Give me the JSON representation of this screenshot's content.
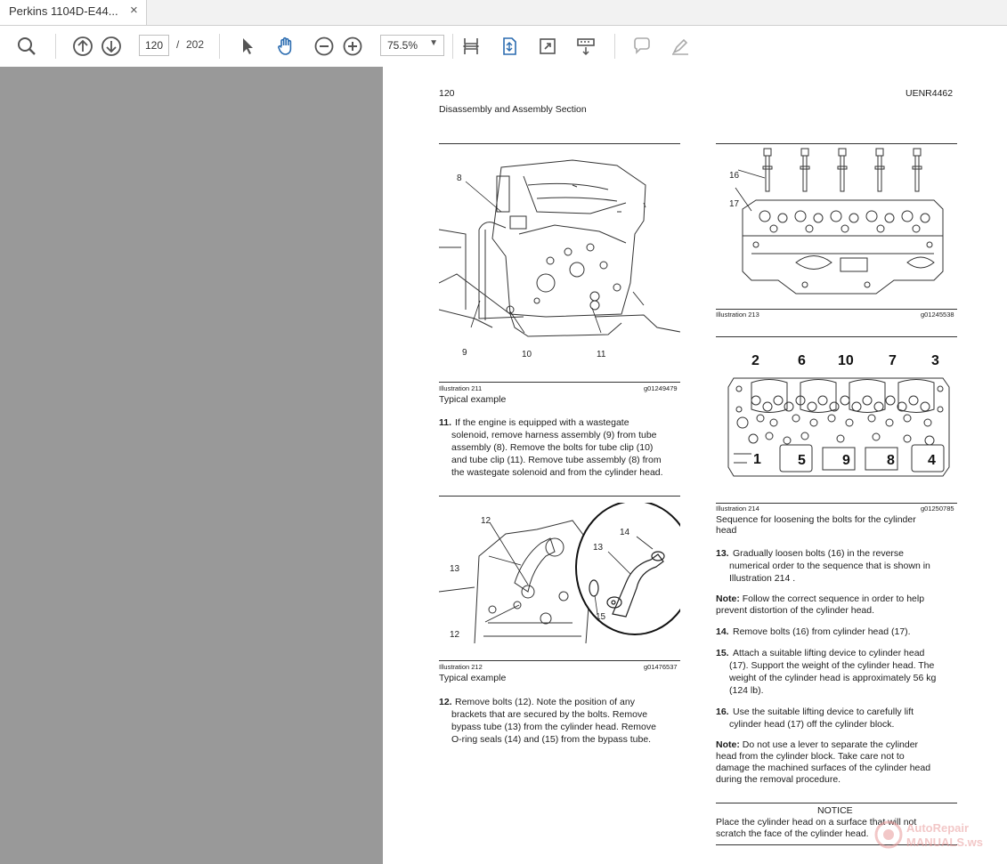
{
  "tab": {
    "title": "Perkins 1104D-E44...",
    "close_glyph": "×"
  },
  "toolbar": {
    "page_current": "120",
    "page_separator": "/",
    "page_total": "202",
    "zoom": "75.5%",
    "icons": [
      "search-icon",
      "page-up-icon",
      "page-down-icon",
      "select-arrow-icon",
      "hand-tool-icon",
      "zoom-out-icon",
      "zoom-in-icon",
      "zoom-dropdown-icon",
      "fit-width-icon",
      "fit-page-icon",
      "full-screen-icon",
      "read-mode-icon",
      "comment-icon",
      "highlight-pen-icon"
    ]
  },
  "page": {
    "number": "120",
    "doc_id": "UENR4462",
    "section": "Disassembly and Assembly Section",
    "fig211": {
      "label": "Illustration 211",
      "code": "g01249479",
      "caption": "Typical example",
      "callouts": [
        "8",
        "9",
        "10",
        "11"
      ]
    },
    "step11": {
      "num": "11.",
      "lines": [
        "If the engine is equipped with a wastegate",
        "solenoid, remove harness assembly (9) from tube",
        "assembly (8). Remove the bolts for tube clip (10)",
        "and tube clip (11). Remove tube assembly (8) from",
        "the wastegate solenoid and from the cylinder head."
      ]
    },
    "fig212": {
      "label": "Illustration 212",
      "code": "g01476537",
      "caption": "Typical example",
      "callouts": [
        "12",
        "13",
        "12",
        "14",
        "13",
        "15"
      ]
    },
    "step12": {
      "num": "12.",
      "lines": [
        "Remove bolts (12). Note the position of any",
        "brackets that are secured by the bolts. Remove",
        "bypass tube (13) from the cylinder head. Remove",
        "O-ring seals (14) and (15) from the bypass tube."
      ]
    },
    "fig213": {
      "label": "Illustration 213",
      "code": "g01245538",
      "callouts": [
        "16",
        "17"
      ]
    },
    "fig214": {
      "label": "Illustration 214",
      "code": "g01250785",
      "caption_lines": [
        "Sequence for loosening the bolts for the cylinder",
        "head"
      ],
      "top_numbers": [
        "2",
        "6",
        "10",
        "7",
        "3"
      ],
      "bottom_numbers": [
        "1",
        "5",
        "9",
        "8",
        "4"
      ]
    },
    "step13": {
      "num": "13.",
      "lines": [
        "Gradually loosen bolts (16) in the reverse",
        "numerical order to the sequence that is shown in",
        "Illustration 214 ."
      ]
    },
    "note1": {
      "label": "Note:",
      "lines": [
        " Follow the correct sequence in order to help",
        "prevent distortion of the cylinder head."
      ]
    },
    "step14": {
      "num": "14.",
      "text": "Remove bolts (16) from cylinder head (17)."
    },
    "step15": {
      "num": "15.",
      "lines": [
        "Attach a suitable lifting device to cylinder head",
        "(17). Support the weight of the cylinder head. The",
        "weight of the cylinder head is approximately 56 kg",
        "(124 lb)."
      ]
    },
    "step16": {
      "num": "16.",
      "lines": [
        "Use the suitable lifting device to carefully lift",
        "cylinder head (17) off the cylinder block."
      ]
    },
    "note2": {
      "label": "Note:",
      "lines": [
        " Do not use a lever to separate the cylinder",
        "head from the cylinder block. Take care not to",
        "damage the machined surfaces of the cylinder head",
        "during the removal procedure."
      ]
    },
    "notice": {
      "title": "NOTICE",
      "lines": [
        "Place  the  cylinder  head  on  a  surface  that  will  not",
        "scratch the face of the cylinder head."
      ]
    },
    "watermark": [
      "AutoRepair",
      "MANUALS.ws"
    ]
  },
  "colors": {
    "left_pane": "#999999",
    "toolbar_icon": "#2b6cb0",
    "icon_gray": "#666666",
    "watermark": "#e89a9a"
  }
}
